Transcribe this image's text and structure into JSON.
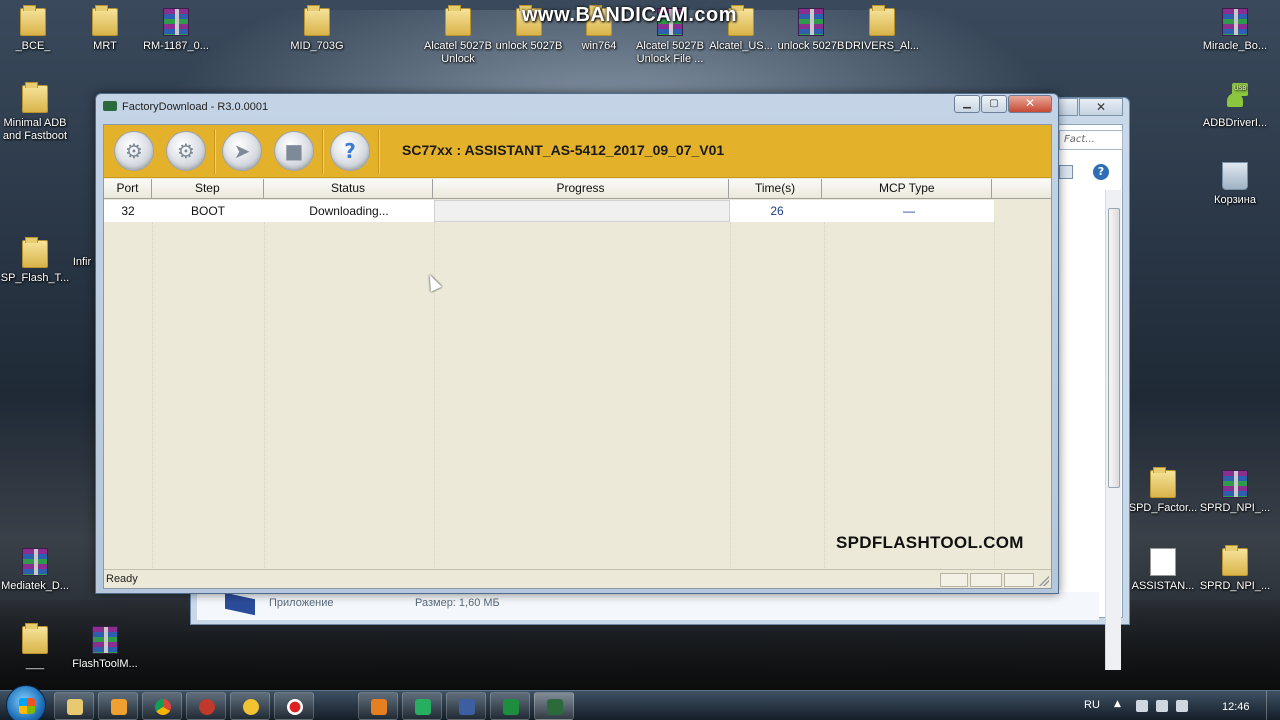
{
  "watermark": "www.BANDICAM.com",
  "desktop": {
    "icons_top": [
      {
        "label": "_BCE_",
        "kind": "folder"
      },
      {
        "label": "MRT",
        "kind": "folder"
      },
      {
        "label": "RM-1187_0...",
        "kind": "rar"
      },
      {
        "label": "MID_703G",
        "kind": "folder"
      },
      {
        "label": "Alcatel 5027B Unlock",
        "kind": "folder"
      },
      {
        "label": "unlock 5027B",
        "kind": "folder"
      },
      {
        "label": "win764",
        "kind": "folder"
      },
      {
        "label": "Alcatel 5027B Unlock File ...",
        "kind": "rar"
      },
      {
        "label": "Alcatel_US...",
        "kind": "folder"
      },
      {
        "label": "unlock 5027B",
        "kind": "rar"
      },
      {
        "label": "DRIVERS_Al...",
        "kind": "folder"
      },
      {
        "label": "Miracle_Bo...",
        "kind": "rar"
      }
    ],
    "icons_left": [
      {
        "label": "Minimal ADB and Fastboot",
        "kind": "folder"
      },
      {
        "label": "SP_Flash_T...",
        "kind": "folder"
      },
      {
        "label": "Infir",
        "kind": "folder"
      },
      {
        "label": "Mediatek_D...",
        "kind": "rar"
      },
      {
        "label": "___",
        "kind": "folder"
      },
      {
        "label": "FlashToolM...",
        "kind": "rar"
      }
    ],
    "icons_right": [
      {
        "label": "ADBDriverI...",
        "kind": "android"
      },
      {
        "label": "Корзина",
        "kind": "bin"
      },
      {
        "label": "SPD_Factor...",
        "kind": "folder"
      },
      {
        "label": "SPRD_NPI_...",
        "kind": "rar"
      },
      {
        "label": "ASSISTAN...",
        "kind": "doc"
      },
      {
        "label": "SPRD_NPI_...",
        "kind": "folder"
      }
    ]
  },
  "background_window": {
    "search_placeholder": "Fact...",
    "details_type": "Приложение",
    "details_size": "Размер: 1,60 МБ"
  },
  "window": {
    "title": "FactoryDownload - R3.0.0001",
    "product": "SC77xx : ASSISTANT_AS-5412_2017_09_07_V01",
    "toolbar_icons": [
      "settings-icon",
      "gears-icon",
      "start-icon",
      "stop-icon",
      "help-icon"
    ],
    "columns": [
      "Port",
      "Step",
      "Status",
      "Progress",
      "Time(s)",
      "MCP Type"
    ],
    "rows": [
      {
        "port": "32",
        "step": "BOOT",
        "status": "Downloading...",
        "progress": 0,
        "time": "26",
        "mcp": "—"
      }
    ],
    "brand": "SPDFLASHTOOL.COM",
    "status_text": "Ready",
    "accent_color": "#e3b22a"
  },
  "taskbar": {
    "language": "RU",
    "clock": "12:46"
  }
}
